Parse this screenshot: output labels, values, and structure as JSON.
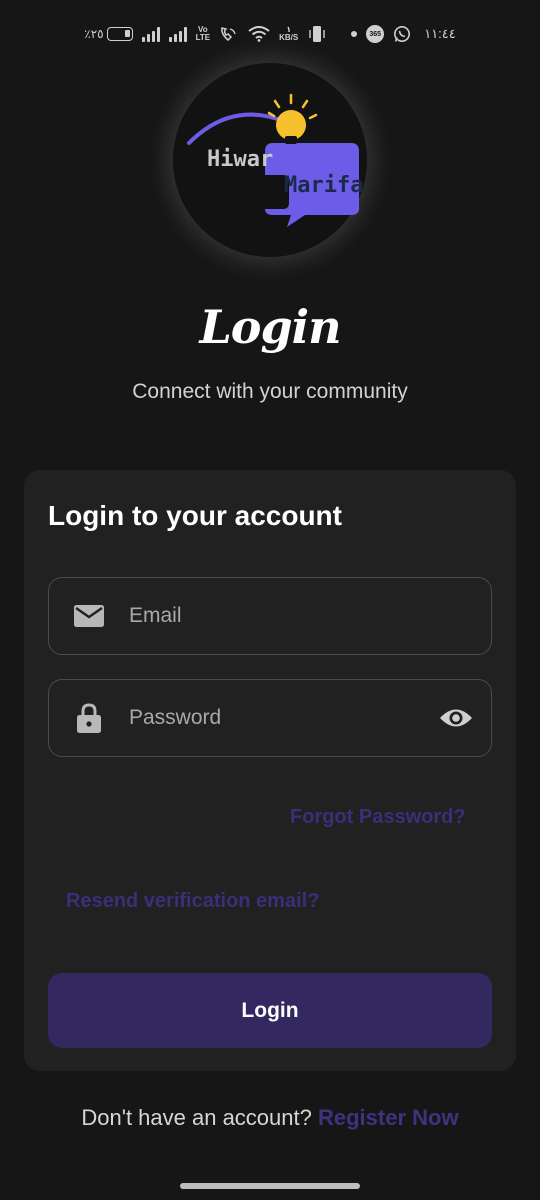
{
  "status_bar": {
    "battery_text": "٪٢٥",
    "volte_top": "Vo",
    "volte_bottom": "LTE",
    "data_rate_top": "١",
    "data_rate_bottom": "KB/S",
    "app_badge": "365",
    "time": "١١:٤٤"
  },
  "logo": {
    "word1": "Hiwar",
    "word2": "Marifa",
    "colors": {
      "purple": "#6c5ce7",
      "bulb": "#f6c12c"
    }
  },
  "header": {
    "title": "Login",
    "subtitle": "Connect with your community"
  },
  "form": {
    "heading": "Login to your account",
    "email_placeholder": "Email",
    "password_placeholder": "Password",
    "forgot_password": "Forgot Password?",
    "resend_verification": "Resend verification email?",
    "login_button": "Login"
  },
  "footer": {
    "prompt": "Don't have an account?",
    "register_link": "Register Now"
  },
  "colors": {
    "background": "#161616",
    "card": "#212121",
    "button": "#33285f",
    "link": "#3a2f78"
  }
}
